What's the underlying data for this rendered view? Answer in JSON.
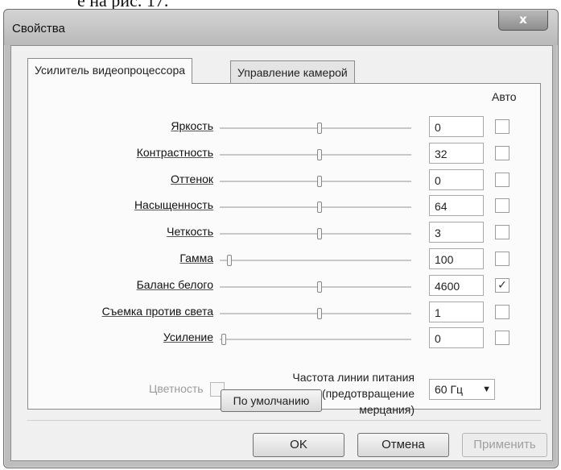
{
  "page_caption": "е на рис. 17.",
  "window": {
    "title": "Свойства",
    "close_glyph": "x"
  },
  "tabs": [
    {
      "label": "Усилитель видеопроцессора",
      "active": true
    },
    {
      "label": "Управление камерой",
      "active": false
    }
  ],
  "auto_header": "Авто",
  "rows": [
    {
      "label": "Яркость",
      "value": "0",
      "slider": 0.52,
      "auto": false
    },
    {
      "label": "Контрастность",
      "value": "32",
      "slider": 0.52,
      "auto": false
    },
    {
      "label": "Оттенок",
      "value": "0",
      "slider": 0.52,
      "auto": false
    },
    {
      "label": "Насыщенность",
      "value": "64",
      "slider": 0.52,
      "auto": false
    },
    {
      "label": "Четкость",
      "value": "3",
      "slider": 0.52,
      "auto": false
    },
    {
      "label": "Гамма",
      "value": "100",
      "slider": 0.05,
      "auto": false
    },
    {
      "label": "Баланс белого",
      "value": "4600",
      "slider": 0.52,
      "auto": true
    },
    {
      "label": "Съемка против света",
      "value": "1",
      "slider": 0.52,
      "auto": false
    },
    {
      "label": "Усиление",
      "value": "0",
      "slider": 0.02,
      "auto": false
    }
  ],
  "chroma": {
    "label": "Цветность"
  },
  "power_line": {
    "label_line1": "Частота линии питания",
    "label_line2": "(предотвращение",
    "label_line3": "мерцания)",
    "value": "60 Гц"
  },
  "default_button": "По умолчанию",
  "buttons": {
    "ok": "OK",
    "cancel": "Отмена",
    "apply": "Применить"
  }
}
